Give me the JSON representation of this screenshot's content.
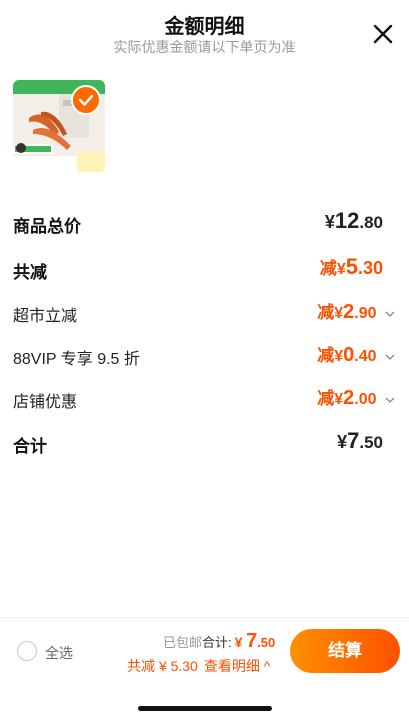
{
  "header": {
    "title": "金额明细",
    "subtitle": "实际优惠金额请以下单页为准"
  },
  "product": {
    "image_alt": "商品图片",
    "selected": true
  },
  "breakdown": {
    "goods_total": {
      "label": "商品总价",
      "yen": "¥",
      "int": "12",
      "dec": ".80"
    },
    "total_reduction": {
      "label": "共减",
      "prefix": "减",
      "yen": "¥",
      "int": "5",
      "dec": ".30"
    },
    "items": [
      {
        "label": "超市立减",
        "prefix": "减",
        "yen": "¥",
        "int": "2",
        "dec": ".90"
      },
      {
        "label": "88VIP 专享 9.5 折",
        "prefix": "减",
        "yen": "¥",
        "int": "0",
        "dec": ".40"
      },
      {
        "label": "店铺优惠",
        "prefix": "减",
        "yen": "¥",
        "int": "2",
        "dec": ".00"
      }
    ],
    "total": {
      "label": "合计",
      "yen": "¥",
      "int": "7",
      "dec": ".50"
    }
  },
  "bottom_bar": {
    "select_all_label": "全选",
    "shipping_note": "已包邮",
    "total_label": "合计:",
    "total_yen": "¥",
    "total_int": "7",
    "total_dec": ".50",
    "discount_text": "共减 ¥ 5.30",
    "detail_link": "查看明细 ^",
    "checkout_label": "结算"
  },
  "colors": {
    "accent": "#ff5000",
    "accent_light": "#ff9000"
  },
  "icons": {
    "close": "close-icon",
    "check": "check-icon",
    "chevron": "chevron-down-icon"
  }
}
